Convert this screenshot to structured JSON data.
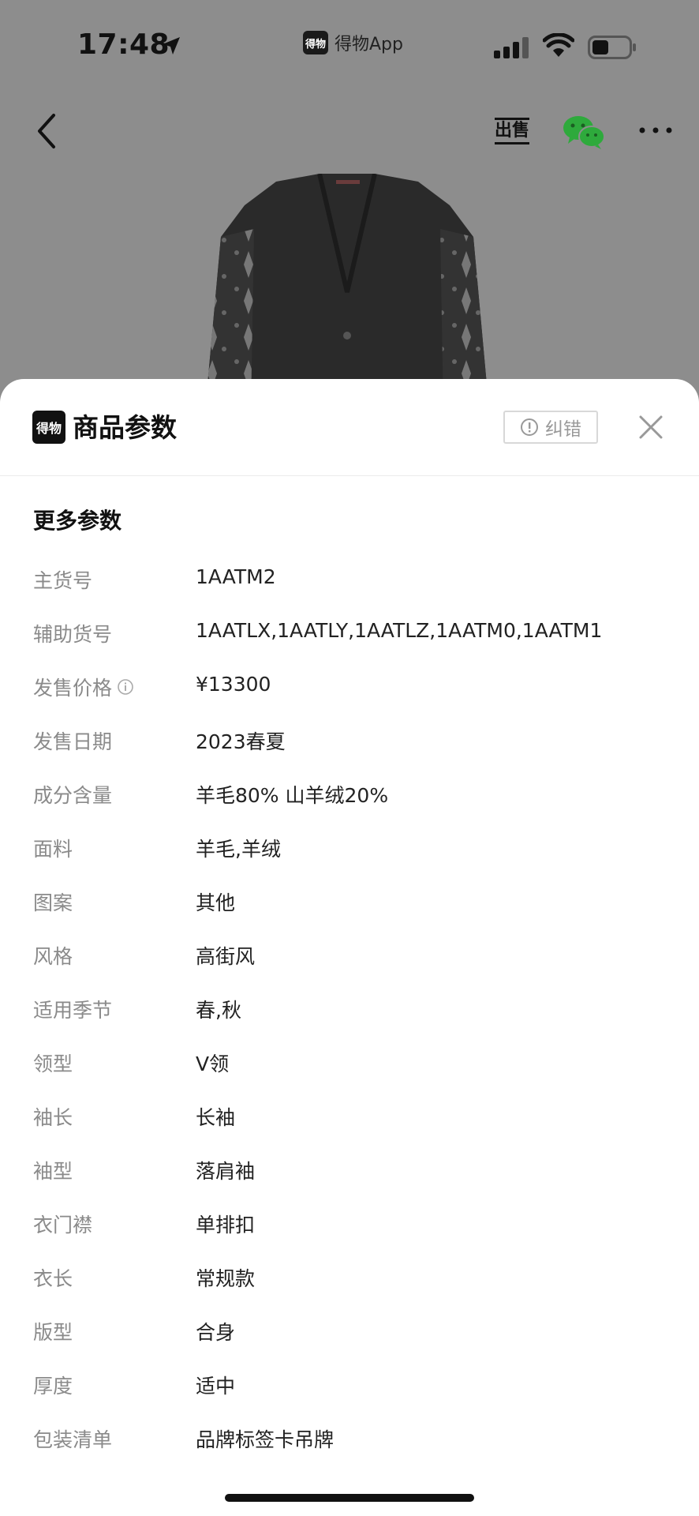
{
  "status_bar": {
    "time": "17:48",
    "app_logo_text": "得物",
    "app_name": "得物App",
    "icons": [
      "location-arrow-icon",
      "signal-icon",
      "wifi-icon",
      "battery-icon"
    ]
  },
  "nav": {
    "icons": [
      "back-chevron-icon",
      "sell-icon",
      "wechat-icon",
      "more-icon"
    ],
    "sell_text": "出售"
  },
  "colors": {
    "backdrop": "#8d8d8d",
    "wechat_green": "#2eaa3c",
    "label_gray": "#8a8a8a",
    "value_dark": "#222222"
  },
  "sheet": {
    "logo_text": "得物",
    "title": "商品参数",
    "correction_label": "纠错",
    "section_title": "更多参数",
    "params": [
      {
        "label": "主货号",
        "value": "1AATM2"
      },
      {
        "label": "辅助货号",
        "value": "1AATLX,1AATLY,1AATLZ,1AATM0,1AATM1"
      },
      {
        "label": "发售价格",
        "value": "¥13300",
        "has_info_icon": true
      },
      {
        "label": "发售日期",
        "value": "2023春夏"
      },
      {
        "label": "成分含量",
        "value": "羊毛80% 山羊绒20%"
      },
      {
        "label": "面料",
        "value": "羊毛,羊绒"
      },
      {
        "label": "图案",
        "value": "其他"
      },
      {
        "label": "风格",
        "value": "高街风"
      },
      {
        "label": "适用季节",
        "value": "春,秋"
      },
      {
        "label": "领型",
        "value": "V领"
      },
      {
        "label": "袖长",
        "value": "长袖"
      },
      {
        "label": "袖型",
        "value": "落肩袖"
      },
      {
        "label": "衣门襟",
        "value": "单排扣"
      },
      {
        "label": "衣长",
        "value": "常规款"
      },
      {
        "label": "版型",
        "value": "合身"
      },
      {
        "label": "厚度",
        "value": "适中"
      },
      {
        "label": "包装清单",
        "value": "品牌标签卡吊牌"
      }
    ]
  }
}
